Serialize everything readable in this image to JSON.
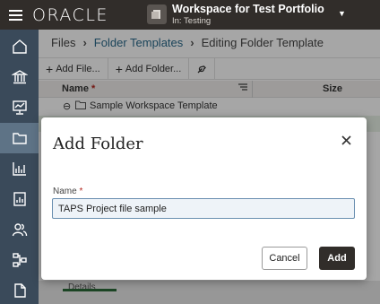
{
  "topbar": {
    "logo": "ORACLE",
    "workspace_title": "Workspace for Test Portfolio",
    "workspace_subtitle": "In: Testing"
  },
  "sidenav": {
    "items": [
      {
        "icon": "home-icon"
      },
      {
        "icon": "bank-icon"
      },
      {
        "icon": "monitor-chart-icon"
      },
      {
        "icon": "folder-icon",
        "active": true
      },
      {
        "icon": "bar-chart-icon"
      },
      {
        "icon": "report-icon"
      },
      {
        "icon": "users-icon"
      },
      {
        "icon": "workflow-icon"
      },
      {
        "icon": "document-icon"
      }
    ]
  },
  "breadcrumb": {
    "files": "Files",
    "folder_templates": "Folder Templates",
    "current": "Editing Folder Template"
  },
  "toolbar": {
    "add_file": "Add File...",
    "add_folder": "Add Folder..."
  },
  "grid": {
    "col_name": "Name",
    "col_size": "Size",
    "rows": [
      {
        "label": "Sample Workspace Template"
      }
    ]
  },
  "dialog": {
    "title": "Add Folder",
    "name_label": "Name",
    "name_value": "TAPS Project file sample",
    "cancel_label": "Cancel",
    "add_label": "Add"
  },
  "bottom": {
    "tab_label": "Details"
  },
  "colors": {
    "topbar": "#312d2a",
    "sidenav": "#3a4a5a",
    "accent_link": "#2c6b8c",
    "primary_button": "#312d2a"
  }
}
